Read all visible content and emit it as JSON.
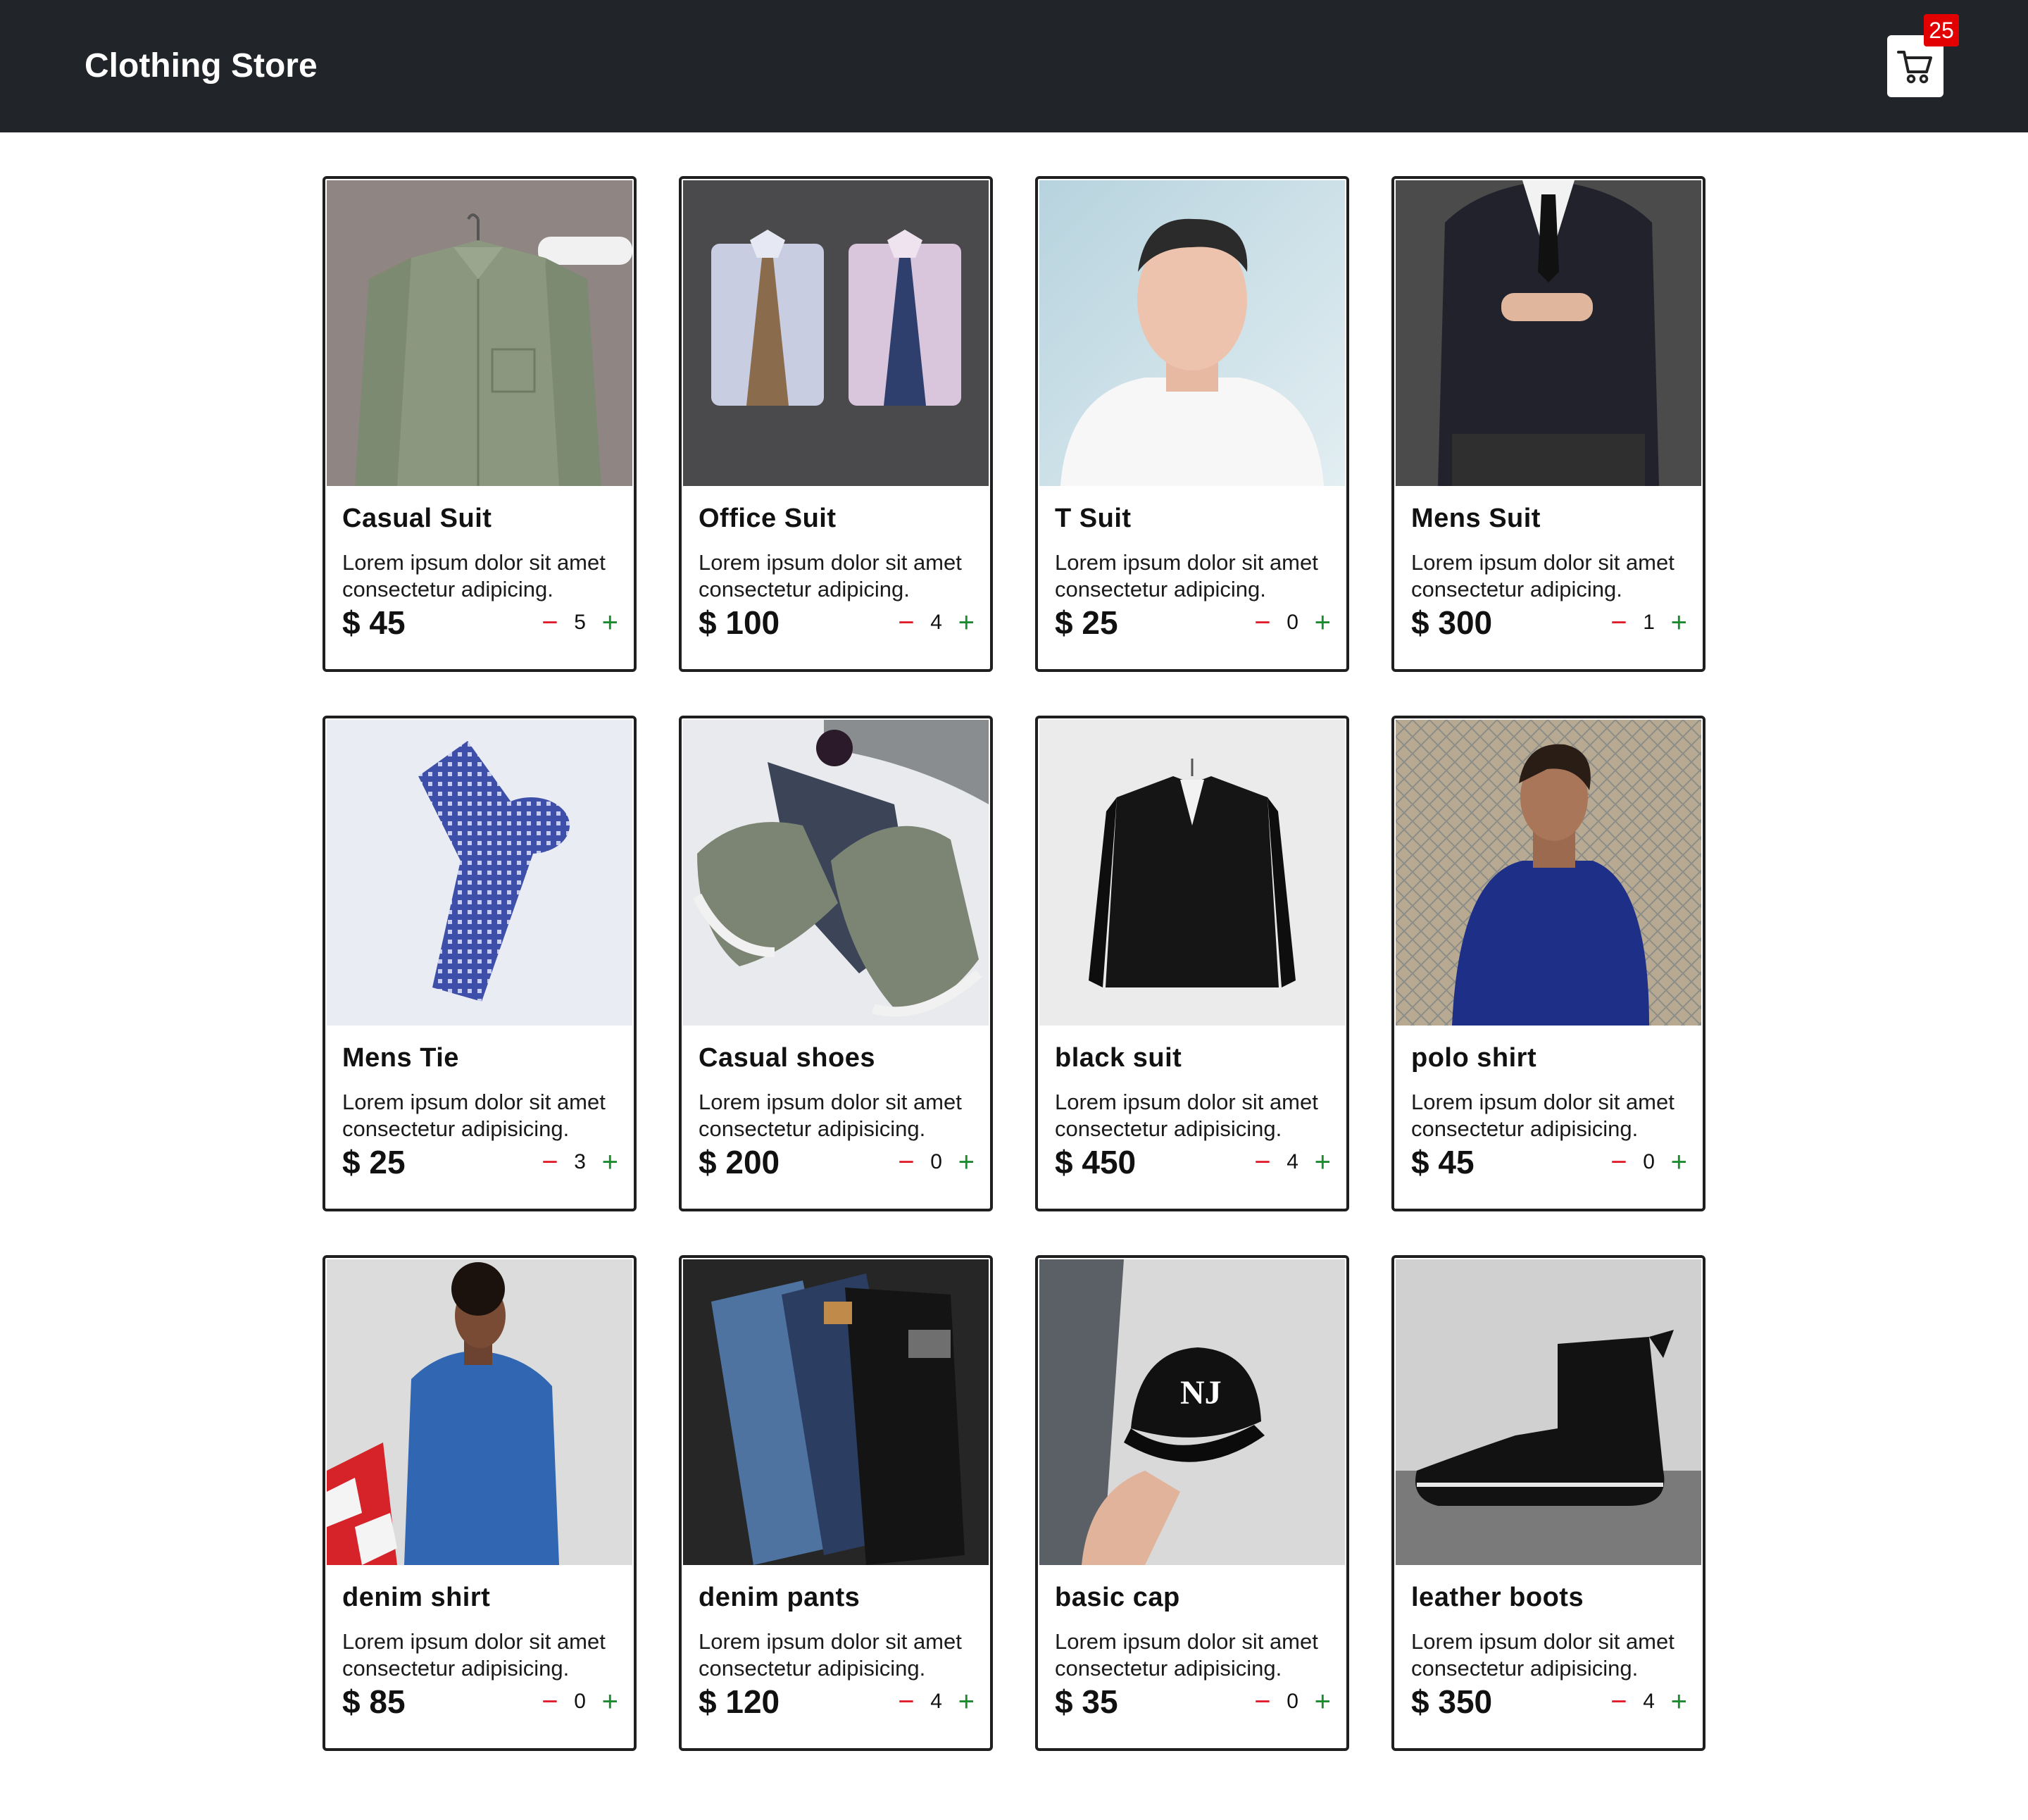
{
  "navbar": {
    "brand": "Clothing Store",
    "cart_icon": "shopping-cart-icon",
    "cart_count": "25",
    "badge_color": "#e20000",
    "background": "#212529"
  },
  "products": [
    {
      "title": "Casual Suit",
      "desc": "Lorem ipsum dolor sit amet consectetur adipicing.",
      "price": "$ 45",
      "qty": "5",
      "image": "green shirt on hanger"
    },
    {
      "title": "Office Suit",
      "desc": "Lorem ipsum dolor sit amet consectetur adipicing.",
      "price": "$ 100",
      "qty": "4",
      "image": "two folded dress shirts with ties"
    },
    {
      "title": "T Suit",
      "desc": "Lorem ipsum dolor sit amet consectetur adipicing.",
      "price": "$ 25",
      "qty": "0",
      "image": "man in white t-shirt"
    },
    {
      "title": "Mens Suit",
      "desc": "Lorem ipsum dolor sit amet consectetur adipicing.",
      "price": "$ 300",
      "qty": "1",
      "image": "man in dark suit"
    },
    {
      "title": "Mens Tie",
      "desc": "Lorem ipsum dolor sit amet consectetur adipisicing.",
      "price": "$ 25",
      "qty": "3",
      "image": "blue patterned tie"
    },
    {
      "title": "Casual shoes",
      "desc": "Lorem ipsum dolor sit amet consectetur adipisicing.",
      "price": "$ 200",
      "qty": "0",
      "image": "olive sneakers"
    },
    {
      "title": "black suit",
      "desc": "Lorem ipsum dolor sit amet consectetur adipisicing.",
      "price": "$ 450",
      "qty": "4",
      "image": "black suit jacket on hanger"
    },
    {
      "title": "polo shirt",
      "desc": "Lorem ipsum dolor sit amet consectetur adipisicing.",
      "price": "$ 45",
      "qty": "0",
      "image": "man in navy polo shirt"
    },
    {
      "title": "denim shirt",
      "desc": "Lorem ipsum dolor sit amet consectetur adipisicing.",
      "price": "$ 85",
      "qty": "0",
      "image": "man in denim jacket"
    },
    {
      "title": "denim pants",
      "desc": "Lorem ipsum dolor sit amet consectetur adipisicing.",
      "price": "$ 120",
      "qty": "4",
      "image": "stacked jeans"
    },
    {
      "title": "basic cap",
      "desc": "Lorem ipsum dolor sit amet consectetur adipisicing.",
      "price": "$ 35",
      "qty": "0",
      "image": "black baseball cap in hand"
    },
    {
      "title": "leather boots",
      "desc": "Lorem ipsum dolor sit amet consectetur adipisicing.",
      "price": "$ 350",
      "qty": "4",
      "image": "black leather boot"
    }
  ],
  "controls": {
    "minus": "−",
    "plus": "+",
    "minus_color": "#e11d2b",
    "plus_color": "#1a8c2e"
  }
}
